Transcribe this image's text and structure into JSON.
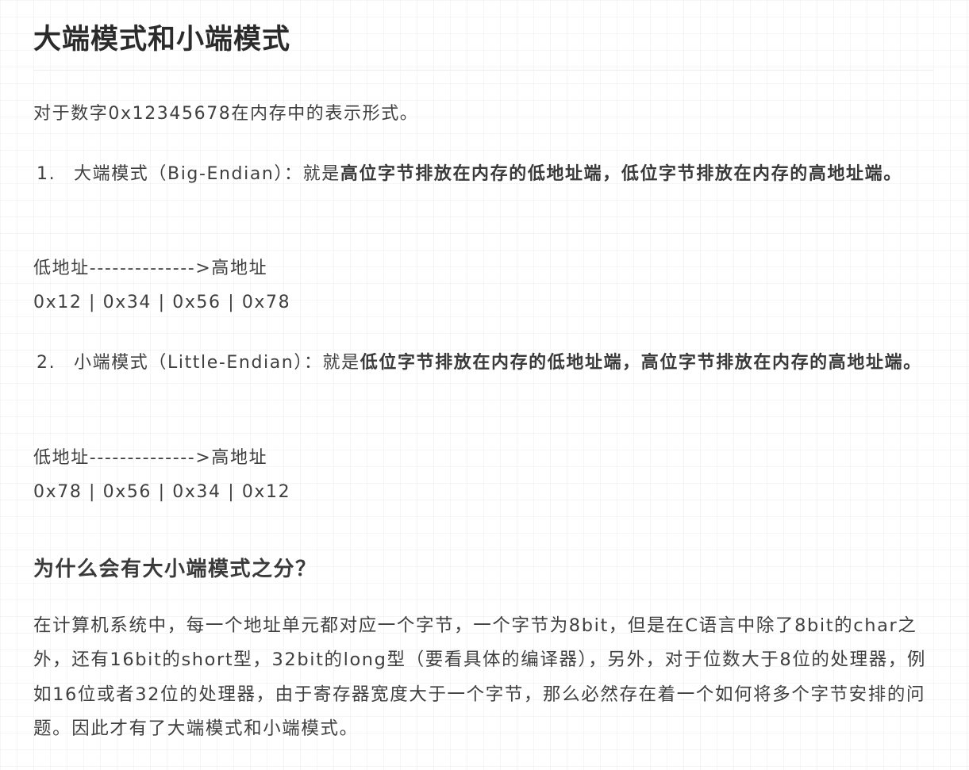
{
  "title": "大端模式和小端模式",
  "intro": "对于数字0x12345678在内存中的表示形式。",
  "list": [
    {
      "number": "1.",
      "lead": "大端模式（Big-Endian）：就是",
      "bold": "高位字节排放在内存的低地址端，低位字节排放在内存的高地址端。",
      "diagram_header": "低地址-------------->高地址",
      "diagram_bytes": "0x12  |  0x34  |  0x56  |  0x78"
    },
    {
      "number": "2.",
      "lead": "小端模式（Little-Endian）：就是",
      "bold": "低位字节排放在内存的低地址端，高位字节排放在内存的高地址端。",
      "diagram_header": "低地址-------------->高地址",
      "diagram_bytes": "0x78  |  0x56  |  0x34  |  0x12"
    }
  ],
  "section_heading": "为什么会有大小端模式之分？",
  "section_paragraph": "在计算机系统中，每一个地址单元都对应一个字节，一个字节为8bit，但是在C语言中除了8bit的char之外，还有16bit的short型，32bit的long型（要看具体的编译器），另外，对于位数大于8位的处理器，例如16位或者32位的处理器，由于寄存器宽度大于一个字节，那么必然存在着一个如何将多个字节安排的问题。因此才有了大端模式和小端模式。"
}
